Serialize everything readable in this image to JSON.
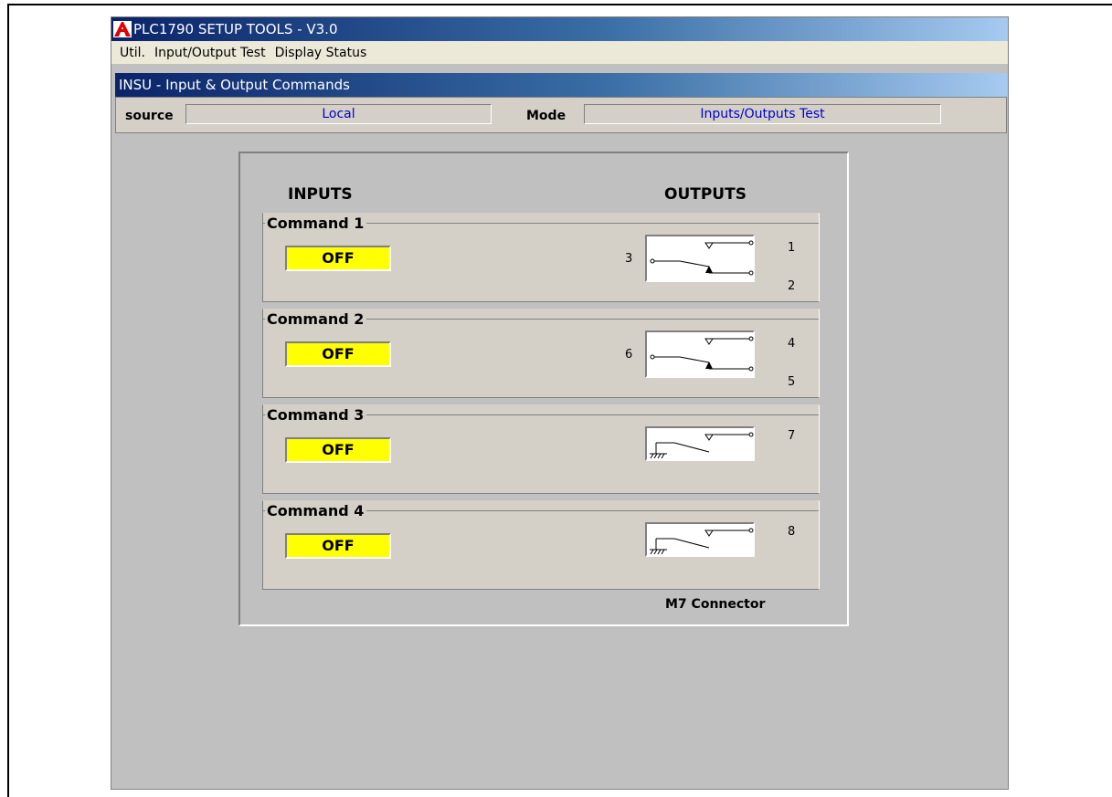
{
  "app": {
    "title": "PLC1790 SETUP TOOLS  -  V3.0",
    "menu": [
      "Util.",
      "Input/Output Test",
      "Display Status"
    ]
  },
  "subwindow": {
    "title": "INSU - Input & Output Commands",
    "source_label": "source",
    "source_value": "Local",
    "mode_label": "Mode",
    "mode_value": "Inputs/Outputs Test"
  },
  "panel": {
    "inputs_header": "INPUTS",
    "outputs_header": "OUTPUTS",
    "connector_label": "M7 Connector",
    "commands": [
      {
        "label": "Command 1",
        "state": "OFF",
        "relay": "changeover",
        "pins": [
          "3",
          "1",
          "2"
        ]
      },
      {
        "label": "Command 2",
        "state": "OFF",
        "relay": "changeover",
        "pins": [
          "6",
          "4",
          "5"
        ]
      },
      {
        "label": "Command 3",
        "state": "OFF",
        "relay": "grounded-no",
        "pins": [
          "7"
        ]
      },
      {
        "label": "Command 4",
        "state": "OFF",
        "relay": "grounded-no",
        "pins": [
          "8"
        ]
      }
    ]
  },
  "colors": {
    "state_off_bg": "#ffff00",
    "field_text": "#0000cc",
    "titlebar_start": "#0a246a",
    "titlebar_end": "#a6caf0"
  }
}
